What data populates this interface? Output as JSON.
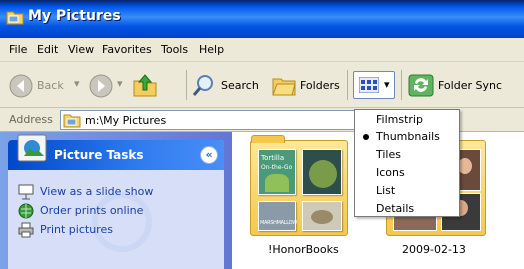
{
  "window": {
    "title": "My Pictures"
  },
  "menu": [
    "File",
    "Edit",
    "View",
    "Favorites",
    "Tools",
    "Help"
  ],
  "toolbar": {
    "back": "Back",
    "search": "Search",
    "folders": "Folders",
    "folder_sync": "Folder Sync"
  },
  "address": {
    "label": "Address",
    "value": "m:\\My Pictures"
  },
  "tasks": {
    "title": "Picture Tasks",
    "items": [
      "View as a slide show",
      "Order prints online",
      "Print pictures"
    ]
  },
  "views_menu": {
    "options": [
      "Filmstrip",
      "Thumbnails",
      "Tiles",
      "Icons",
      "List",
      "Details"
    ],
    "selected": "Thumbnails"
  },
  "folders": [
    {
      "name": "!HonorBooks",
      "thumb_text": [
        "Tortilla",
        "On-the-Go",
        "MARSHMALLOW"
      ]
    },
    {
      "name": "2009-02-13"
    }
  ],
  "colors": {
    "title_bar": "#0054e3",
    "chrome": "#ece9d8",
    "task_pane": "#6f8ddf"
  }
}
